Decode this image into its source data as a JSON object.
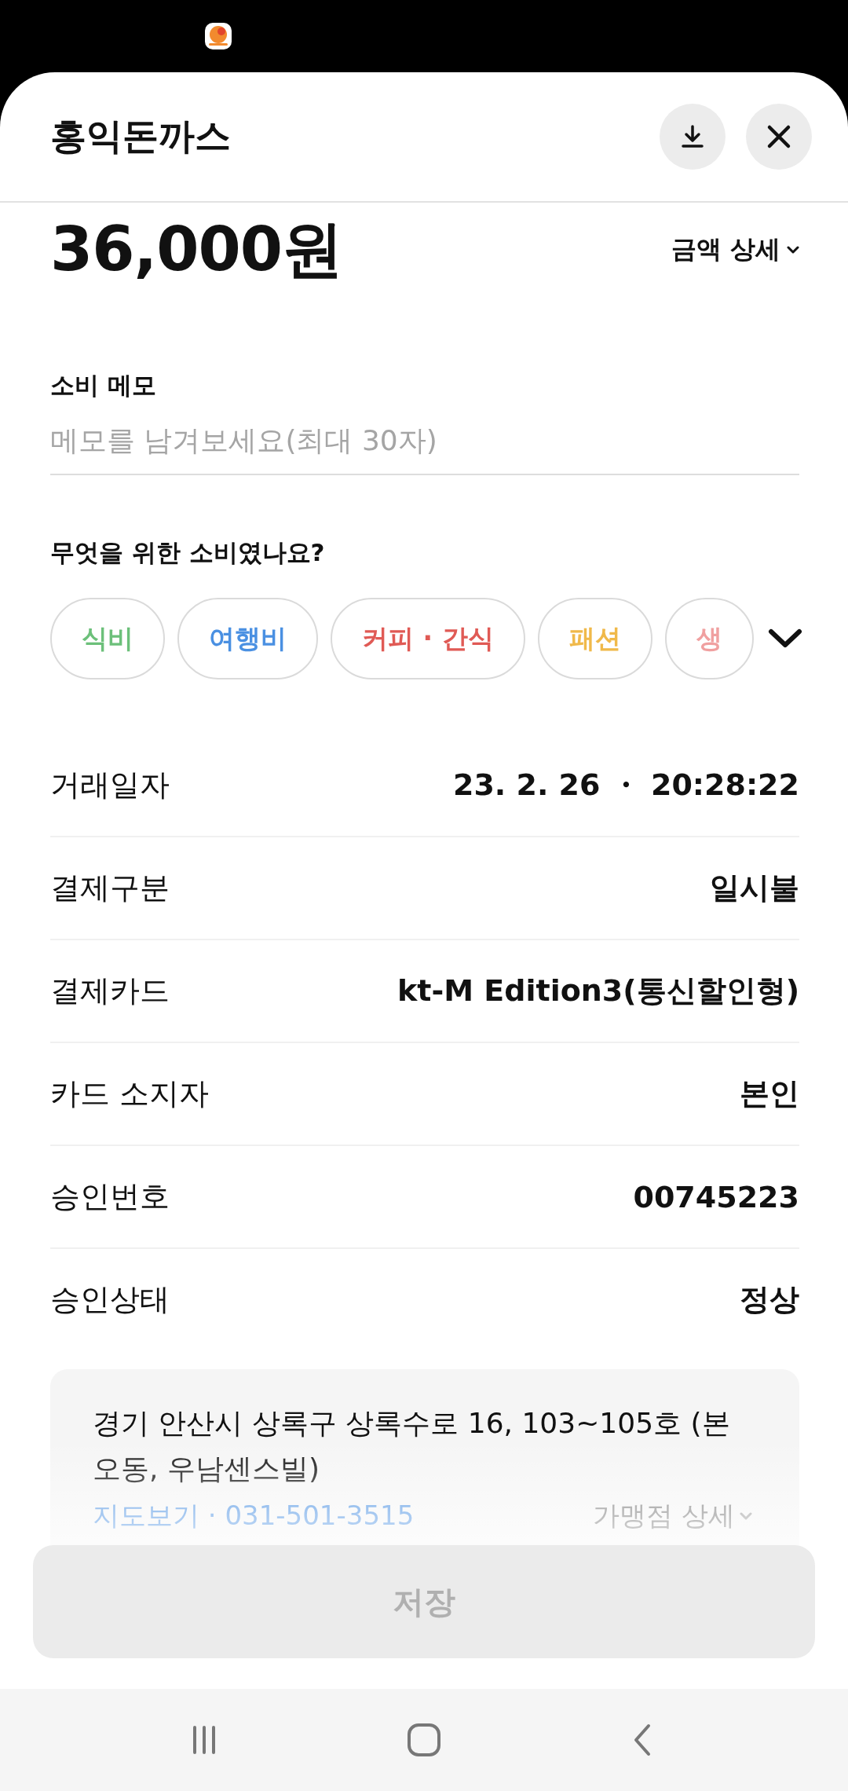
{
  "header": {
    "title": "홍익돈까스"
  },
  "amount": {
    "value": "36,000원",
    "detail_link": "금액 상세"
  },
  "memo": {
    "label": "소비 메모",
    "placeholder": "메모를 남겨보세요(최대 30자)"
  },
  "category": {
    "question": "무엇을 위한 소비였나요?",
    "chips": [
      {
        "label": "식비",
        "color": "#6cc07a"
      },
      {
        "label": "여행비",
        "color": "#4a90e2"
      },
      {
        "label": "커피 · 간식",
        "color": "#e05a55"
      },
      {
        "label": "패션",
        "color": "#f0b94a"
      },
      {
        "label": "생",
        "color": "#f0a0a0"
      }
    ]
  },
  "details": [
    {
      "label": "거래일자",
      "value": "23. 2. 26 ・ 20:28:22"
    },
    {
      "label": "결제구분",
      "value": "일시불"
    },
    {
      "label": "결제카드",
      "value": "kt-M Edition3(통신할인형)"
    },
    {
      "label": "카드 소지자",
      "value": "본인"
    },
    {
      "label": "승인번호",
      "value": "00745223"
    },
    {
      "label": "승인상태",
      "value": "정상"
    }
  ],
  "merchant": {
    "address": "경기 안산시 상록구 상록수로 16, 103~105호 (본오동, 우남센스빌)",
    "map_link": "지도보기",
    "separator": "·",
    "phone": "031-501-3515",
    "detail_link": "가맹점 상세"
  },
  "save_button": {
    "label": "저장",
    "disabled": true
  }
}
